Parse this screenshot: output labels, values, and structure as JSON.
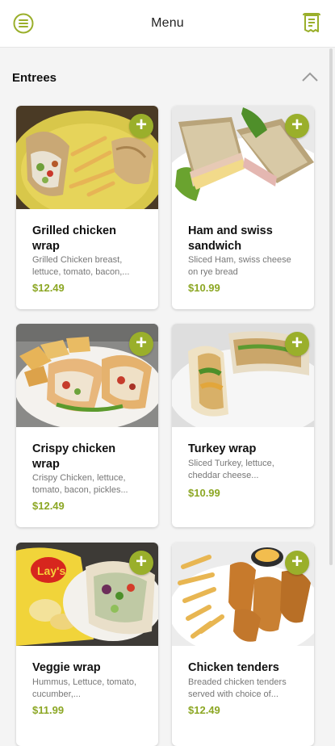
{
  "header": {
    "title": "Menu",
    "menu_icon": "hamburger-circle-icon",
    "order_icon": "receipt-icon"
  },
  "section": {
    "title": "Entrees",
    "collapse_icon": "chevron-up-icon"
  },
  "colors": {
    "accent": "#9aaf2b",
    "price": "#8ca724"
  },
  "items": [
    {
      "name": "Grilled chicken wrap",
      "desc": "Grilled Chicken breast, lettuce, tomato, bacon,...",
      "price": "$12.49",
      "image": "grilled-chicken-wrap-photo"
    },
    {
      "name": "Ham and swiss sandwich",
      "desc": "Sliced Ham, swiss cheese on rye bread",
      "price": "$10.99",
      "image": "ham-swiss-sandwich-photo"
    },
    {
      "name": "Crispy chicken wrap",
      "desc": "Crispy Chicken, lettuce, tomato, bacon, pickles...",
      "price": "$12.49",
      "image": "crispy-chicken-wrap-photo"
    },
    {
      "name": "Turkey wrap",
      "desc": "Sliced Turkey, lettuce, cheddar cheese...",
      "price": "$10.99",
      "image": "turkey-wrap-photo"
    },
    {
      "name": "Veggie wrap",
      "desc": "Hummus, Lettuce, tomato, cucumber,...",
      "price": "$11.99",
      "image": "veggie-wrap-photo"
    },
    {
      "name": "Chicken tenders",
      "desc": "Breaded chicken tenders served with choice of...",
      "price": "$12.49",
      "image": "chicken-tenders-photo"
    }
  ]
}
